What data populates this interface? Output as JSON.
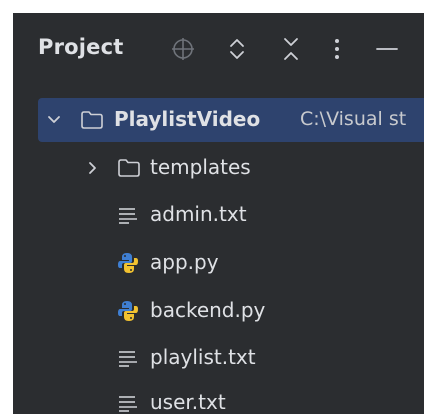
{
  "panel": {
    "title": "Project",
    "toolbar_icons": [
      "crosshair-icon",
      "expand-all-icon",
      "collapse-all-icon",
      "more-options-icon",
      "minimize-icon"
    ]
  },
  "tree": {
    "root": {
      "name": "PlaylistVideo",
      "path": "C:\\Visual st",
      "expanded": true,
      "selected": true,
      "icon": "folder-icon"
    },
    "items": [
      {
        "name": "templates",
        "icon": "folder-icon",
        "expandable": true,
        "expanded": false
      },
      {
        "name": "admin.txt",
        "icon": "text-file-icon"
      },
      {
        "name": "app.py",
        "icon": "python-file-icon"
      },
      {
        "name": "backend.py",
        "icon": "python-file-icon"
      },
      {
        "name": "playlist.txt",
        "icon": "text-file-icon"
      },
      {
        "name": "user.txt",
        "icon": "text-file-icon"
      }
    ]
  },
  "colors": {
    "panel_bg": "#2b2d30",
    "selection": "#2e436e",
    "text": "#dfe1e5",
    "icon": "#ced0d6",
    "python_blue": "#3f7fd3",
    "python_yellow": "#f2c230"
  }
}
